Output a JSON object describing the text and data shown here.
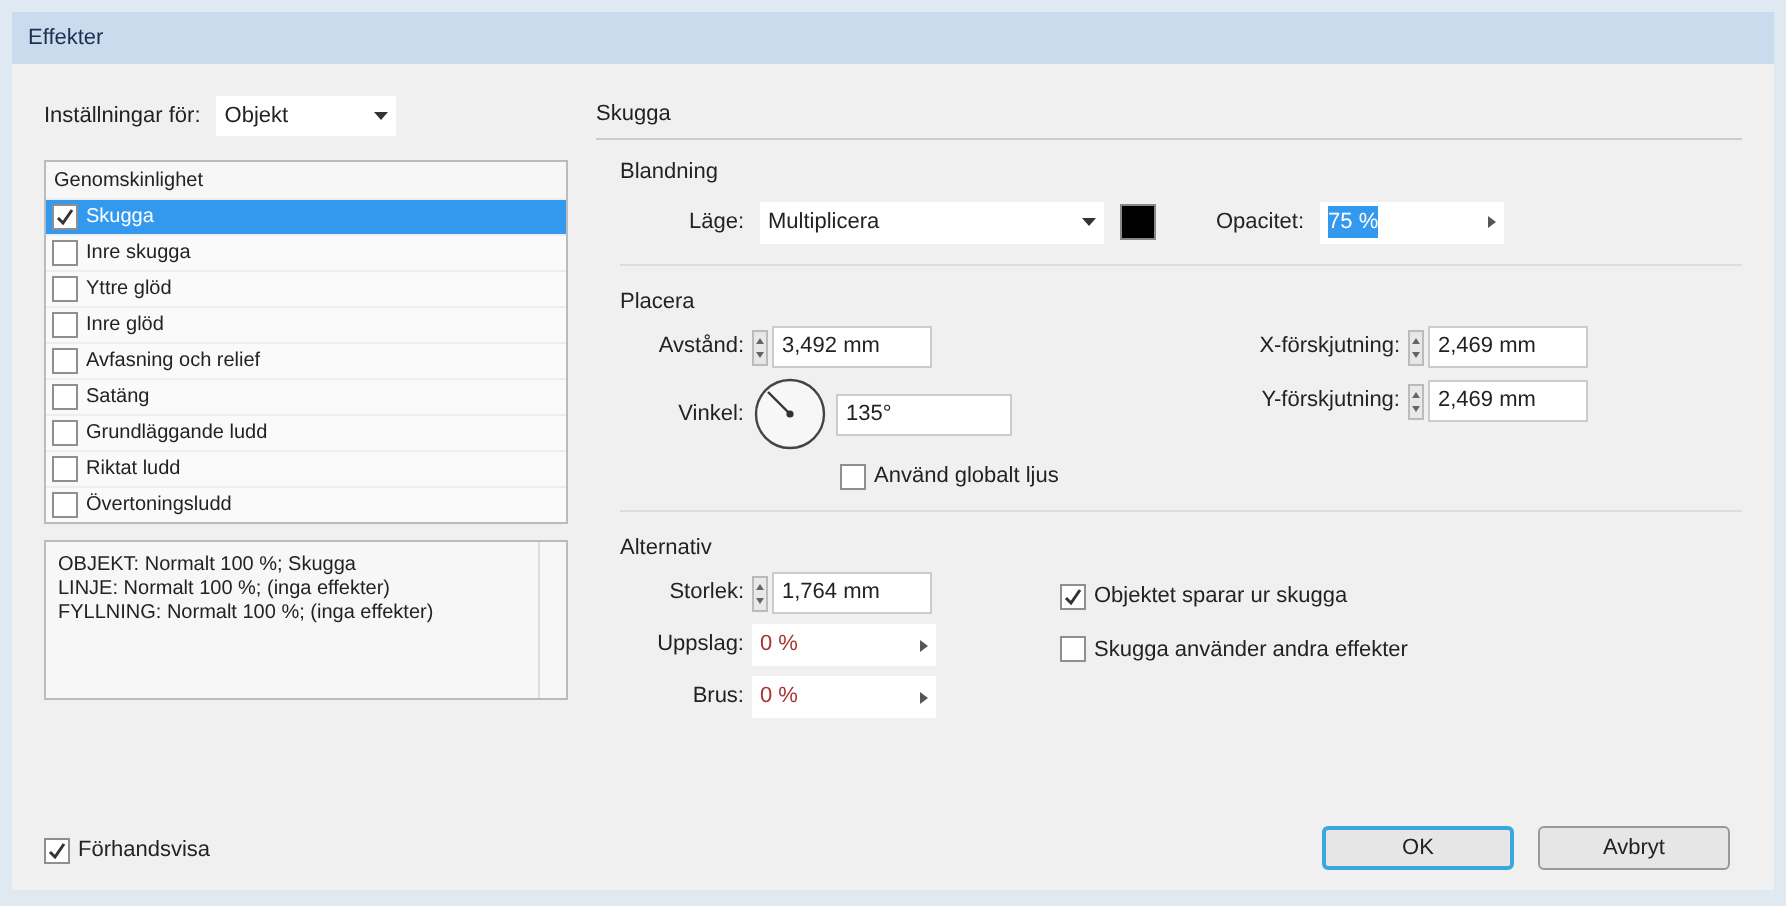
{
  "window": {
    "title": "Effekter"
  },
  "settings_for": {
    "label": "Inställningar för:",
    "value": "Objekt"
  },
  "effects_list": {
    "header": "Genomskinlighet",
    "items": [
      {
        "label": "Skugga",
        "checked": true,
        "selected": true
      },
      {
        "label": "Inre skugga",
        "checked": false,
        "selected": false
      },
      {
        "label": "Yttre glöd",
        "checked": false,
        "selected": false
      },
      {
        "label": "Inre glöd",
        "checked": false,
        "selected": false
      },
      {
        "label": "Avfasning och relief",
        "checked": false,
        "selected": false
      },
      {
        "label": "Satäng",
        "checked": false,
        "selected": false
      },
      {
        "label": "Grundläggande ludd",
        "checked": false,
        "selected": false
      },
      {
        "label": "Riktat ludd",
        "checked": false,
        "selected": false
      },
      {
        "label": "Övertoningsludd",
        "checked": false,
        "selected": false
      }
    ]
  },
  "summary": [
    "OBJEKT: Normalt 100 %; Skugga",
    "LINJE: Normalt 100 %; (inga effekter)",
    "FYLLNING: Normalt 100 %; (inga effekter)"
  ],
  "preview": {
    "label": "Förhandsvisa",
    "checked": true
  },
  "panel_title": "Skugga",
  "blending": {
    "title": "Blandning",
    "mode_label": "Läge:",
    "mode": "Multiplicera",
    "color": "#000000",
    "opacity_label": "Opacitet:",
    "opacity": "75 %"
  },
  "position": {
    "title": "Placera",
    "distance_label": "Avstånd:",
    "distance": "3,492 mm",
    "angle_label": "Vinkel:",
    "angle": "135°",
    "x_offset_label": "X-förskjutning:",
    "x_offset": "2,469 mm",
    "y_offset_label": "Y-förskjutning:",
    "y_offset": "2,469 mm",
    "global_light": {
      "label": "Använd globalt ljus",
      "checked": false
    }
  },
  "options": {
    "title": "Alternativ",
    "size_label": "Storlek:",
    "size": "1,764 mm",
    "spread_label": "Uppslag:",
    "spread": "0 %",
    "noise_label": "Brus:",
    "noise": "0 %",
    "checks": [
      {
        "label": "Objektet sparar ur skugga",
        "checked": true
      },
      {
        "label": "Skugga använder andra effekter",
        "checked": false
      }
    ]
  },
  "buttons": [
    {
      "label": "OK",
      "kind": "default"
    },
    {
      "label": "Avbryt",
      "kind": "normal"
    }
  ]
}
